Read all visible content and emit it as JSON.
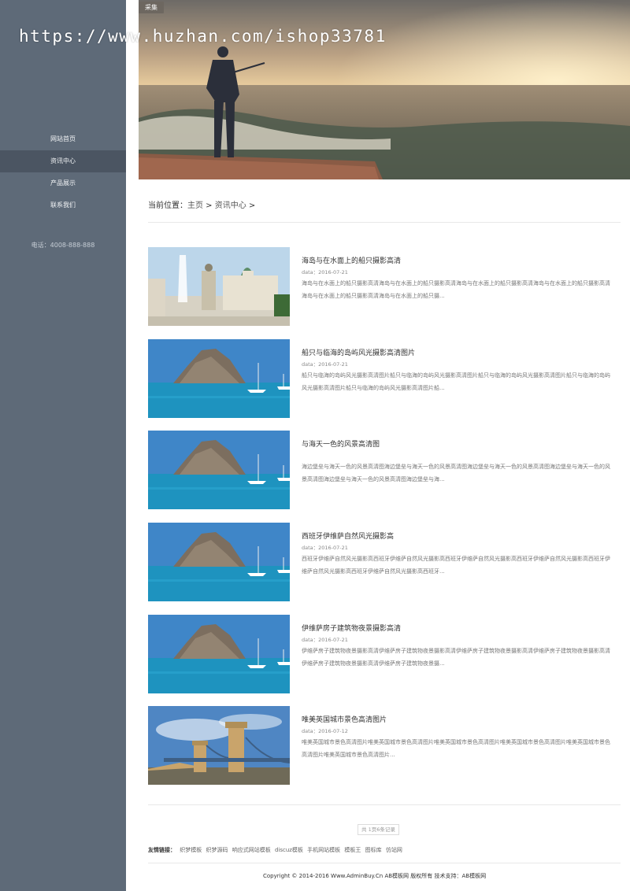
{
  "watermark": "https://www.huzhan.com/ishop33781",
  "banner": {
    "badge": "采集"
  },
  "sidebar": {
    "items": [
      {
        "label": "网站首页"
      },
      {
        "label": "资讯中心"
      },
      {
        "label": "产品展示"
      },
      {
        "label": "联系我们"
      }
    ],
    "phone": "电话：4008-888-888"
  },
  "breadcrumb": {
    "prefix": "当前位置：",
    "home": "主页",
    "sep": " > ",
    "current": "资讯中心",
    "trail": " >"
  },
  "articles": [
    {
      "title": "海岛与在水面上的船只摄影高清",
      "date": "data：2016-07-21",
      "summary": "海岛与在水面上的船只摄影高清海岛与在水面上的船只摄影高清海岛与在水面上的船只摄影高清海岛与在水面上的船只摄影高清海岛与在水面上的船只摄影高清海岛与在水面上的船只摄...",
      "image": "palace-fountain"
    },
    {
      "title": "船只与临海的岛屿风光摄影高清图片",
      "date": "data：2016-07-21",
      "summary": "船只与临海的岛屿风光摄影高清图片船只与临海的岛屿风光摄影高清图片船只与临海的岛屿风光摄影高清图片船只与临海的岛屿风光摄影高清图片船只与临海的岛屿风光摄影高清图片船...",
      "image": "island-sea"
    },
    {
      "title": "与海天一色的风景高清图",
      "date": "",
      "summary": "海边堡垒与海天一色的风景高清图海边堡垒与海天一色的风景高清图海边堡垒与海天一色的风景高清图海边堡垒与海天一色的风景高清图海边堡垒与海天一色的风景高清图海边堡垒与海...",
      "image": "island-sea"
    },
    {
      "title": "西班牙伊维萨自然风光摄影高",
      "date": "data：2016-07-21",
      "summary": "西班牙伊维萨自然风光摄影高西班牙伊维萨自然风光摄影高西班牙伊维萨自然风光摄影高西班牙伊维萨自然风光摄影高西班牙伊维萨自然风光摄影高西班牙伊维萨自然风光摄影高西班牙...",
      "image": "island-sea"
    },
    {
      "title": "伊维萨房子建筑物夜景摄影高清",
      "date": "data：2016-07-21",
      "summary": "伊维萨房子建筑物夜景摄影高清伊维萨房子建筑物夜景摄影高清伊维萨房子建筑物夜景摄影高清伊维萨房子建筑物夜景摄影高清伊维萨房子建筑物夜景摄影高清伊维萨房子建筑物夜景摄...",
      "image": "island-sea"
    },
    {
      "title": "唯美英国城市景色高清图片",
      "date": "data：2016-07-12",
      "summary": "唯美英国城市景色高清图片唯美英国城市景色高清图片唯美英国城市景色高清图片唯美英国城市景色高清图片唯美英国城市景色高清图片唯美英国城市景色高清图片...",
      "image": "tower-bridge"
    }
  ],
  "pager": "共 1页6条记录",
  "friend_links": {
    "label": "友情链接：",
    "items": [
      "织梦模板",
      "织梦源码",
      "响应式网站模板",
      "discuz模板",
      "手机网站模板",
      "模板王",
      "图标库",
      "仿站网"
    ]
  },
  "footer": {
    "copyright": "Copyright © 2014-2016 Www.AdminBuy.Cn AB模板网 版权所有 技术支持：AB模板网"
  }
}
